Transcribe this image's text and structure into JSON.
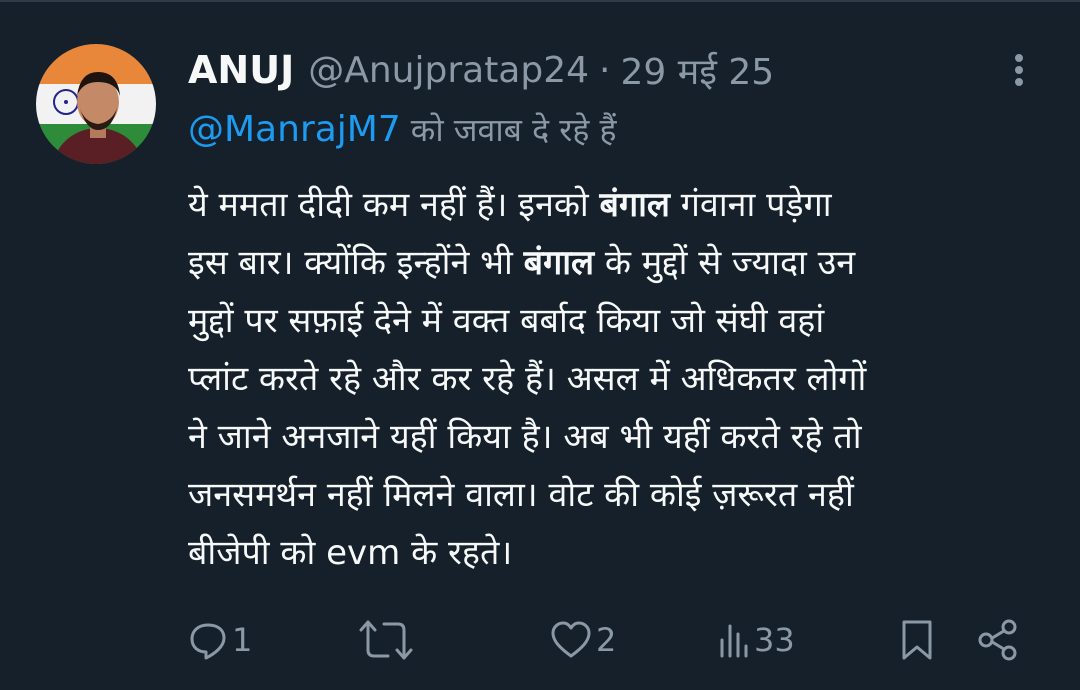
{
  "tweet": {
    "display_name": "ANUJ",
    "handle": "@Anujpratap24",
    "separator": "·",
    "date": "29 मई 25",
    "reply_to_handle": "@ManrajM7",
    "reply_suffix": "को जवाब दे रहे हैं",
    "body": {
      "l1a": "ये ममता दीदी कम नहीं हैं। इनको ",
      "l1b": "बंगाल",
      "l1c": " गंवाना पड़ेगा",
      "l2a": "इस बार। क्योंकि इन्होंने भी ",
      "l2b": "बंगाल",
      "l2c": " के मुद्दों से ज्यादा उन",
      "l3": "मुद्दों पर सफ़ाई देने में वक्त बर्बाद किया जो संघी वहां",
      "l4": "प्लांट करते रहे और कर रहे हैं। असल में अधिकतर लोगों",
      "l5": "ने जाने अनजाने यहीं किया है। अब भी यहीं करते रहे तो",
      "l6": "जनसमर्थन नहीं मिलने वाला। वोट की कोई ज़रूरत नहीं",
      "l7": "बीजेपी को evm के रहते।"
    },
    "actions": {
      "reply_count": "1",
      "retweet_count": "",
      "like_count": "2",
      "views_count": "33"
    }
  },
  "icons": {
    "reply": "reply-icon",
    "retweet": "retweet-icon",
    "like": "heart-icon",
    "views": "views-icon",
    "bookmark": "bookmark-icon",
    "share": "share-icon",
    "more": "more-vertical-icon"
  },
  "colors": {
    "background": "#15202b",
    "text_primary": "#f7f9f9",
    "text_secondary": "#8b98a5",
    "link": "#1d9bf0"
  }
}
